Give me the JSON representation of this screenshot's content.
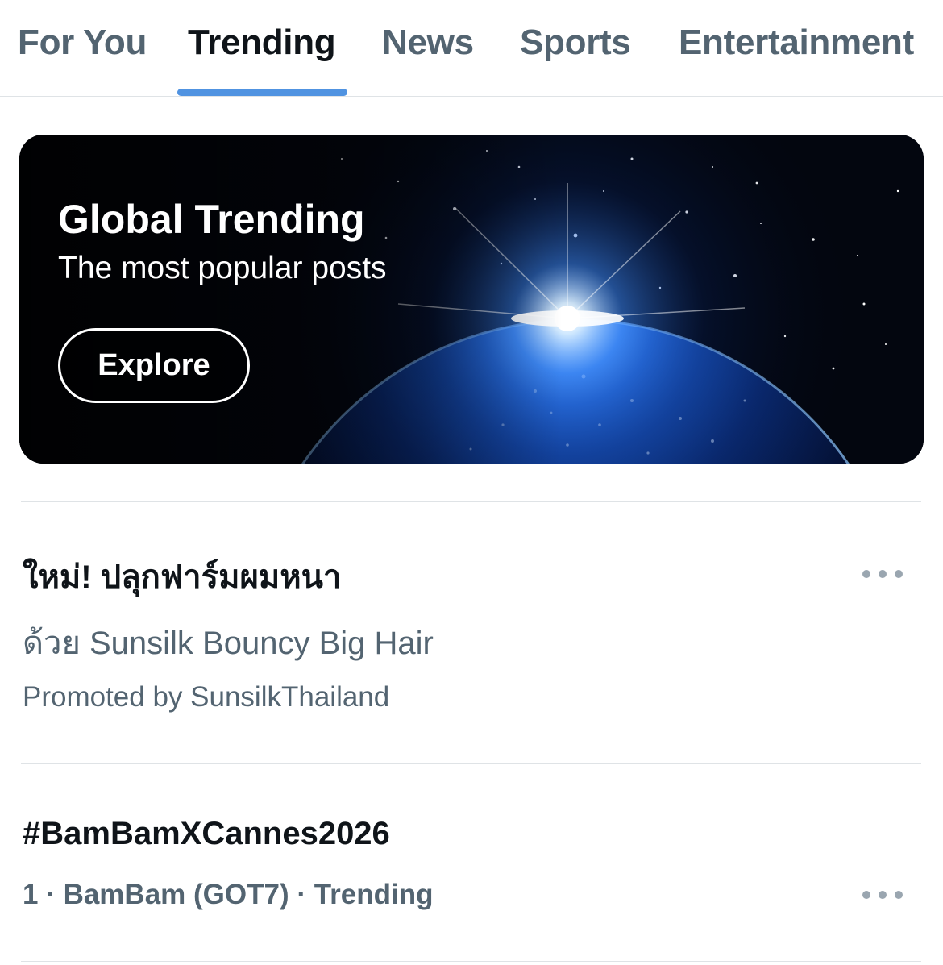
{
  "tabs": [
    {
      "label": "For You",
      "active": false
    },
    {
      "label": "Trending",
      "active": true
    },
    {
      "label": "News",
      "active": false
    },
    {
      "label": "Sports",
      "active": false
    },
    {
      "label": "Entertainment",
      "active": false
    }
  ],
  "banner": {
    "title": "Global Trending",
    "subtitle": "The most popular posts",
    "button_label": "Explore"
  },
  "trends": [
    {
      "title": "ใหม่! ปลุกฟาร์มผมหนา",
      "subtitle": "ด้วย Sunsilk Bouncy Big Hair",
      "meta": "Promoted by SunsilkThailand",
      "more_icon": "more-horizontal-icon"
    },
    {
      "title": "#BamBamXCannes2026",
      "meta": "1 · BamBam (GOT7) · Trending",
      "more_icon": "more-horizontal-icon"
    }
  ],
  "colors": {
    "accent": "#5093e1",
    "text_primary": "#0f1419",
    "text_secondary": "#536471",
    "divider": "#dfe3e6"
  }
}
